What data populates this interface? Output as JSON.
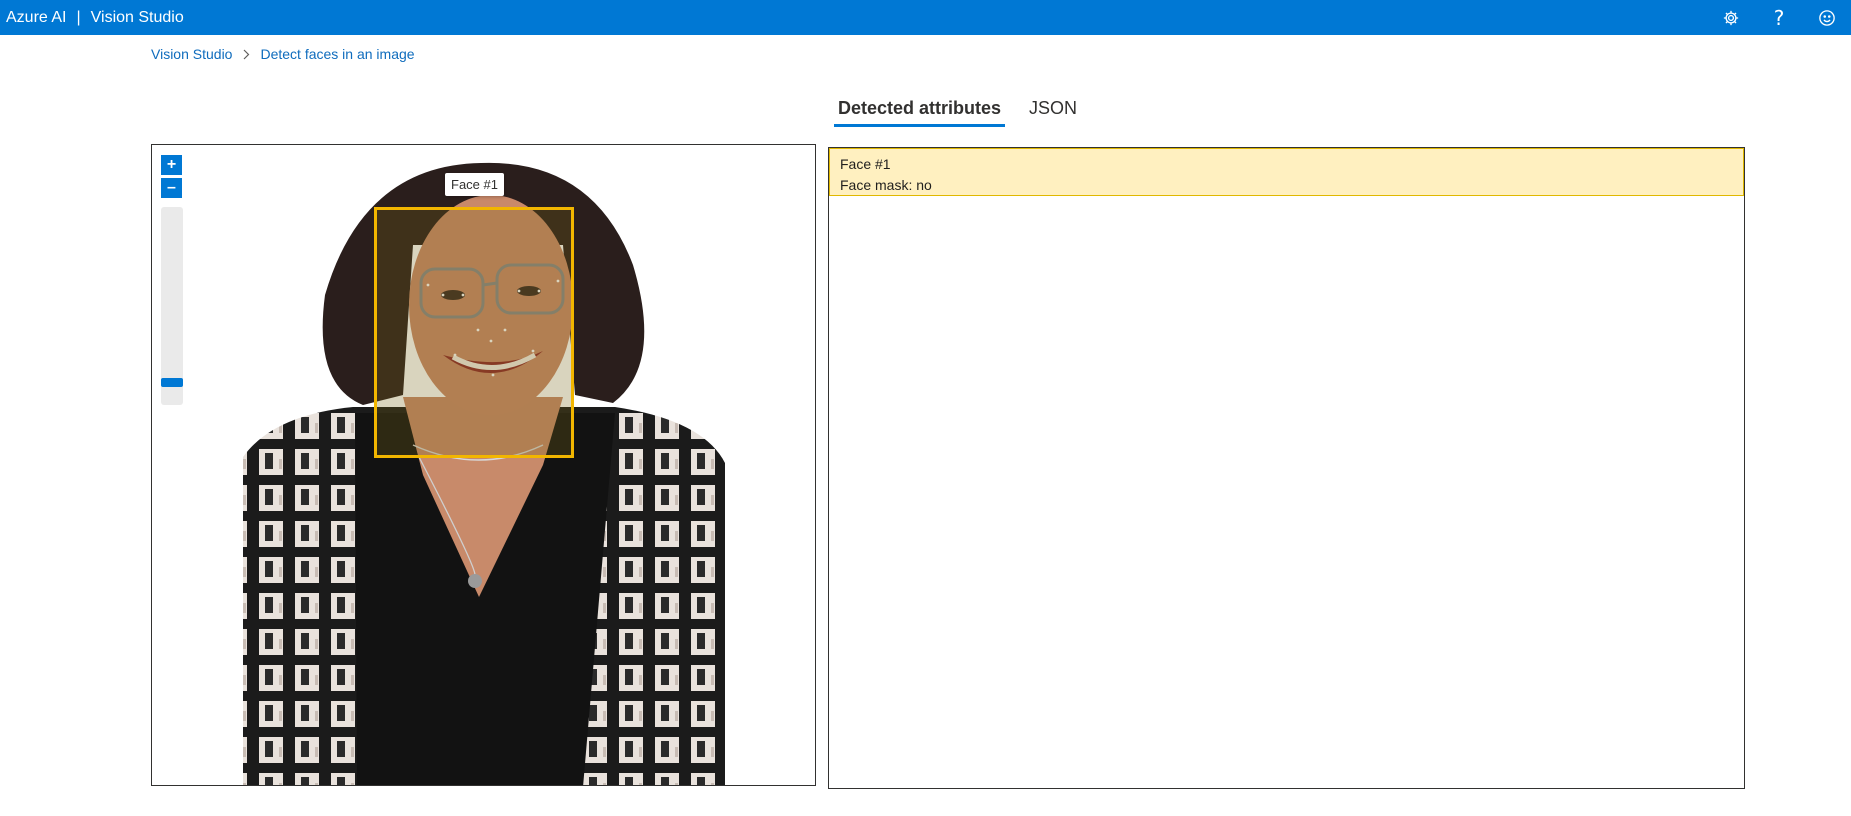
{
  "header": {
    "brand": "Azure AI",
    "separator": "|",
    "product": "Vision Studio",
    "icons": [
      "gear-icon",
      "help-icon",
      "feedback-smiley-icon"
    ],
    "help_glyph": "?"
  },
  "breadcrumb": {
    "items": [
      "Vision Studio",
      "Detect faces in an image"
    ]
  },
  "tabs": [
    {
      "label": "Detected attributes",
      "active": true
    },
    {
      "label": "JSON",
      "active": false
    }
  ],
  "zoom": {
    "plus": "+",
    "minus": "–",
    "level": 0.08
  },
  "detection": {
    "label": "Face #1"
  },
  "results": {
    "faces": [
      {
        "title": "Face #1",
        "mask": "Face mask: no"
      }
    ]
  },
  "colors": {
    "accent": "#0078d4",
    "box": "#f2b600",
    "card_bg": "#fff0c0",
    "link": "#0f6cbd"
  }
}
